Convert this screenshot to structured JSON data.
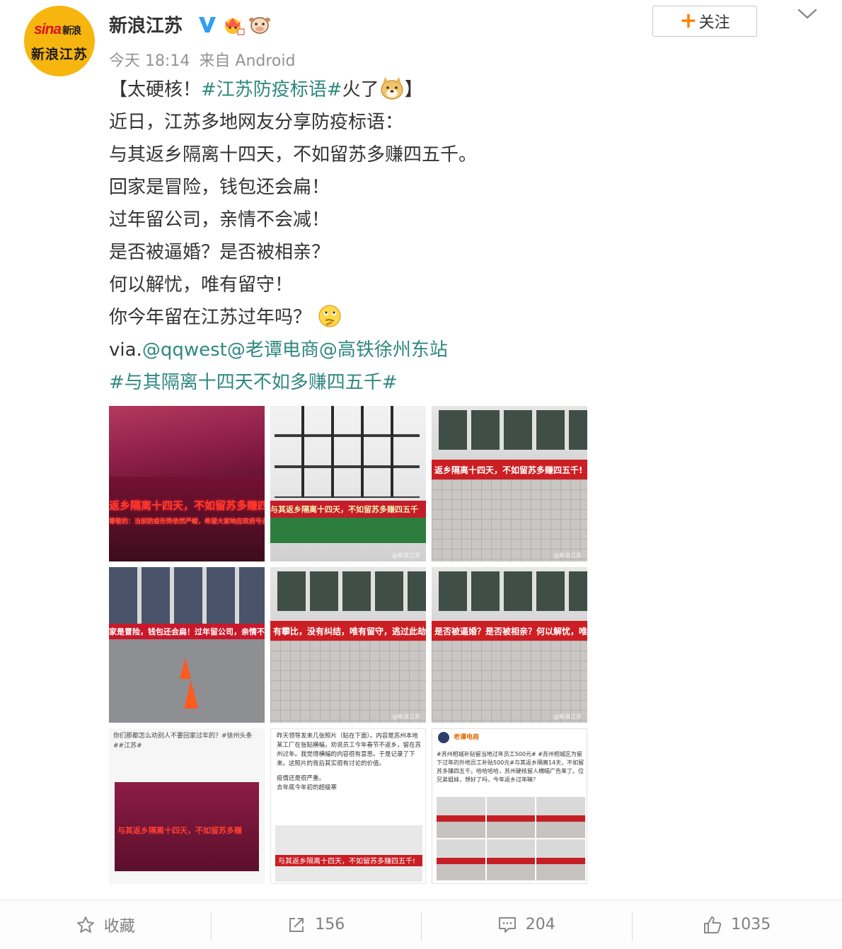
{
  "post": {
    "author": "新浪江苏",
    "avatar_text_top": "sina",
    "avatar_text_top_suffix": "新浪",
    "avatar_text_bottom": "新浪江苏",
    "time": "今天 18:14",
    "source": "来自 Android",
    "follow_label": "关注",
    "colors": {
      "link": "#2f8880",
      "follow_plus": "#ff8200",
      "verified": "#2e9ff5"
    },
    "content": {
      "l1_pre": "【太硬核！",
      "l1_topic": "#江苏防疫标语#",
      "l1_post": "火了",
      "l1_end": "】",
      "l2": "近日，江苏多地网友分享防疫标语：",
      "l3": "与其返乡隔离十四天，不如留苏多赚四五千。",
      "l4": "回家是冒险，钱包还会扁！",
      "l5": "过年留公司，亲情不会减！",
      "l6": "是否被逼婚？是否被相亲？",
      "l7": "何以解忧，唯有留守！",
      "l8": "你今年留在江苏过年吗？",
      "via_prefix": "via.",
      "mention1": "@qqwest",
      "mention2": "@老谭电商",
      "mention3": "@高铁徐州东站",
      "topic2": "#与其隔离十四天不如多赚四五千#"
    }
  },
  "images": {
    "p1_banner": "返乡隔离十四天，不如留苏多赚四五千。",
    "p1_sub": "尊敬的：当前防疫形势依然严峻，希望大家响应政府号召，留苏过年",
    "p2_banner": "与其返乡隔离十四天，不如留苏多赚四五千",
    "p3_banner": "返乡隔离十四天，不如留苏多赚四五千!",
    "p4_banner": "家是冒险，钱包还会扁！过年留公司，亲情不",
    "p5_banner": "有攀比，没有纠结，唯有留守，逃过此劫",
    "p6_banner": "是否被逼婚？是否被相亲？何以解忧，唯有留守!",
    "p7_text": "你们那都怎么劝别人不要回家过年的？#徐州头条##江苏#",
    "p7_banner": "与其返乡隔离十四天，不如留苏多赚",
    "p8_text": "昨天领导发来几张照片（贴在下面）。内容是苏州本地某工厂在张贴横幅，劝说员工今年春节不返乡，留在苏州过年。我觉得横幅的内容很有意思。于是记录了下来。这照片的背后其实很有讨论的价值。",
    "p8_text2": "疫情还是很严重。",
    "p8_text3": "去年底今年初的超级寒",
    "p8_banner": "与其返乡隔离十四天，不如留苏多赚四五千!",
    "p9_author": "老谭电商",
    "p9_text": "#苏州相城补贴留当地过年员工500元# #苏州相城区为留下过年的外地员工补贴500元#与其返乡隔离14天，不如留苏多赚四五千。哈哈哈哈，苏州硬核留人横幅广告来了。位兄弟姐妹，想好了吗，今年返乡过年嘛？",
    "watermark": "@新浪江苏"
  },
  "toolbar": {
    "favorite_label": "收藏",
    "repost_count": "156",
    "comment_count": "204",
    "like_count": "1035"
  }
}
